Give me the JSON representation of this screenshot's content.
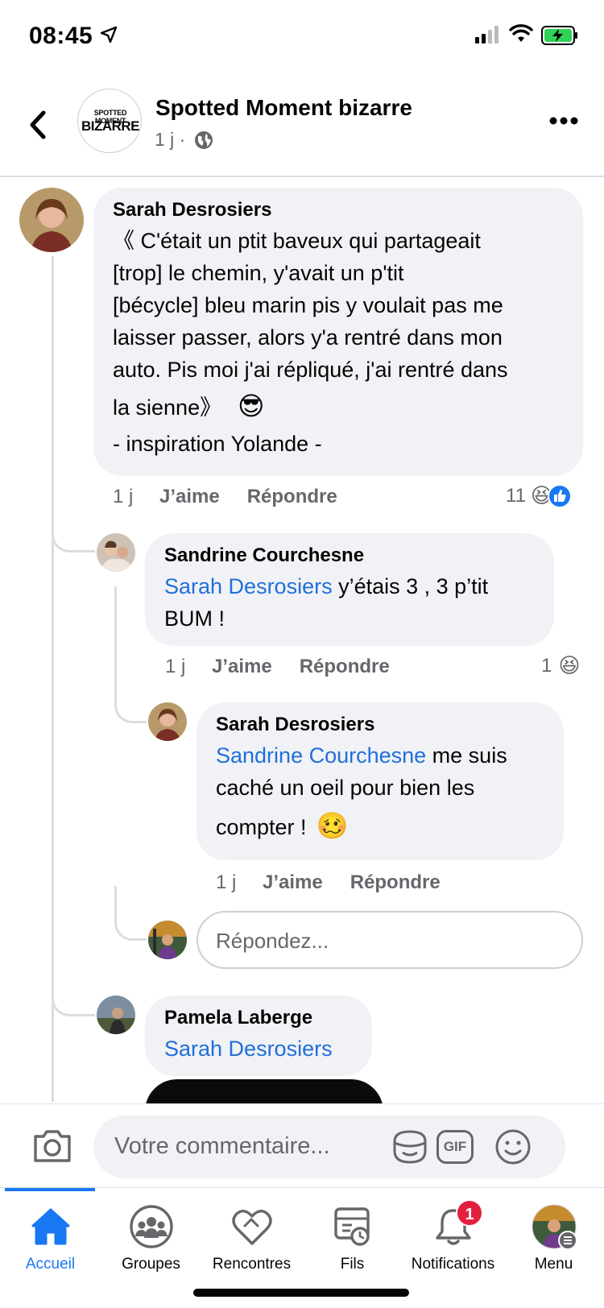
{
  "status_bar": {
    "time": "08:45"
  },
  "header": {
    "page_logo_line1": "SPOTTED MOMENT",
    "page_logo_line2": "BIZARRE",
    "page_name": "Spotted Moment bizarre",
    "post_age": "1 j ·"
  },
  "comments": [
    {
      "author": "Sarah Desrosiers",
      "lines": [
        "《 C'était un ptit baveux qui partageait",
        "[trop] le chemin, y'avait un p'tit",
        "[bécycle] bleu marin pis y voulait pas me",
        "laisser passer, alors y'a rentré dans mon",
        "auto. Pis moi j'ai répliqué, j'ai rentré dans",
        "la sienne》",
        "- inspiration Yolande -"
      ],
      "emoji": "😎",
      "time": "1 j",
      "like": "J’aime",
      "reply": "Répondre",
      "reaction_count": "11",
      "reaction_emoji": "😆"
    },
    {
      "author": "Sandrine Courchesne",
      "mention": "Sarah Desrosiers",
      "text_after_mention": " y’étais 3 , 3 p’tit",
      "line2": "BUM !",
      "time": "1 j",
      "like": "J’aime",
      "reply": "Répondre",
      "reaction_count": "1",
      "reaction_emoji": "😆"
    },
    {
      "author": "Sarah Desrosiers",
      "mention": "Sandrine Courchesne",
      "text_after_mention": " me suis",
      "line2": "caché un oeil pour bien les",
      "line3": "compter !",
      "emoji": "🥴",
      "time": "1 j",
      "like": "J’aime",
      "reply": "Répondre"
    },
    {
      "author": "Pamela Laberge",
      "mention": "Sarah Desrosiers"
    }
  ],
  "reply_input": {
    "placeholder": "Répondez..."
  },
  "composer": {
    "placeholder": "Votre commentaire...",
    "gif_label": "GIF"
  },
  "tabs": [
    {
      "label": "Accueil",
      "icon": "home-icon",
      "active": true
    },
    {
      "label": "Groupes",
      "icon": "groups-icon"
    },
    {
      "label": "Rencontres",
      "icon": "dating-heart-icon"
    },
    {
      "label": "Fils",
      "icon": "feeds-icon"
    },
    {
      "label": "Notifications",
      "icon": "bell-icon",
      "badge": "1"
    },
    {
      "label": "Menu",
      "icon": "menu-avatar-icon"
    }
  ],
  "colors": {
    "accent": "#1877f2",
    "mention": "#216fdb",
    "bubble": "#f0f2f5",
    "badge": "#e41e3f"
  }
}
